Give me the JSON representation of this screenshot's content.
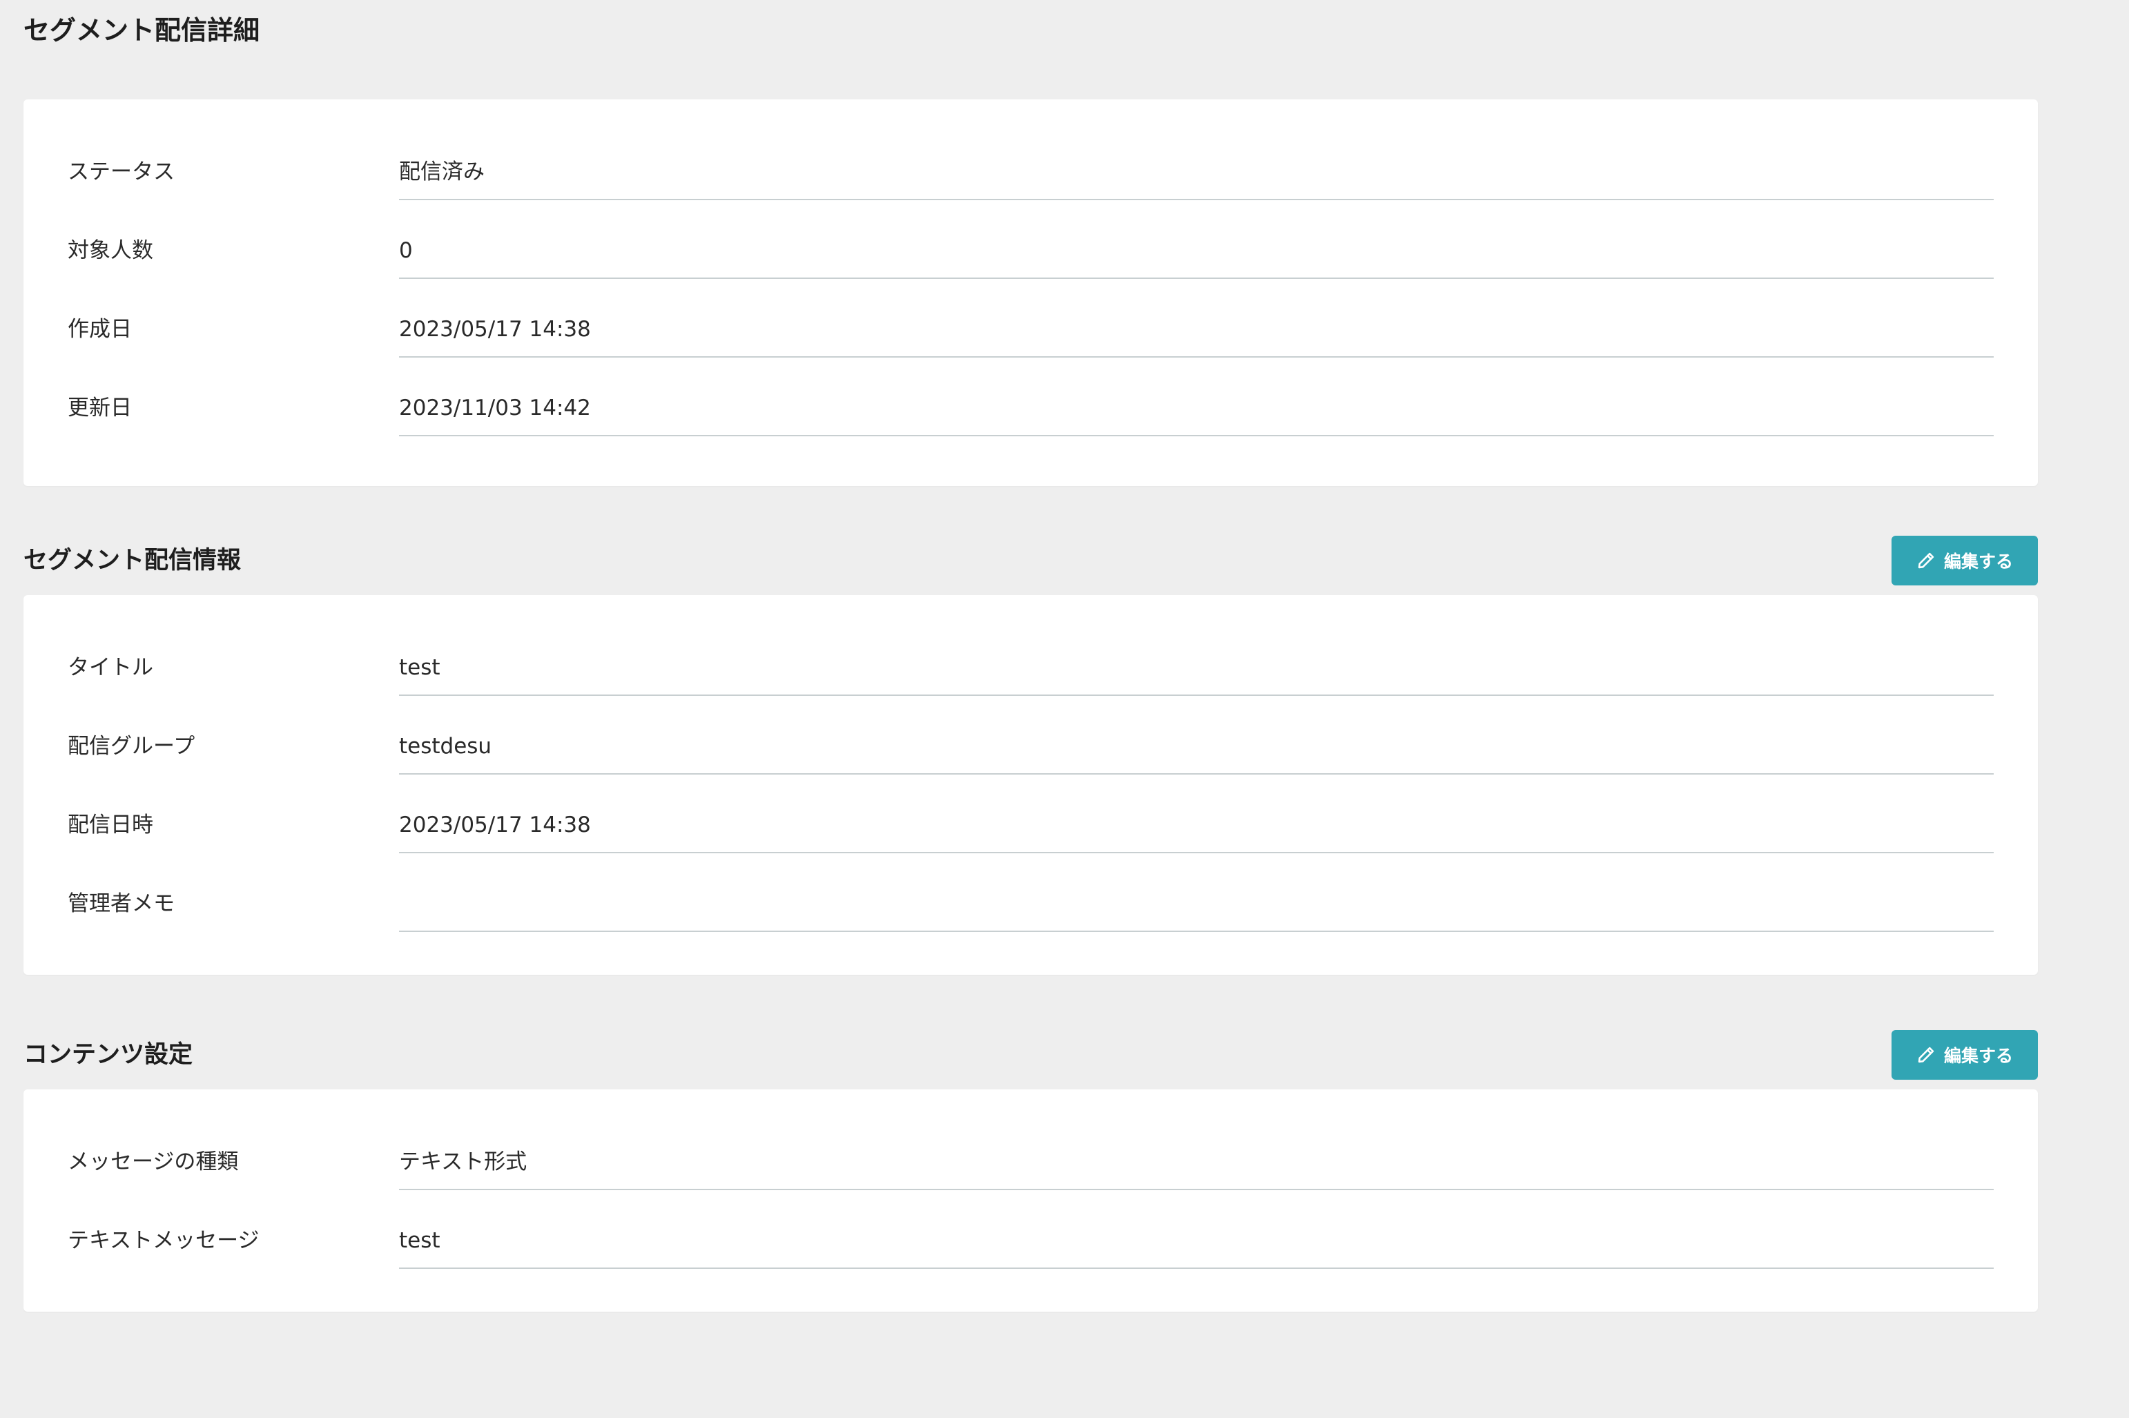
{
  "page": {
    "title": "セグメント配信詳細"
  },
  "summary": {
    "rows": [
      {
        "label": "ステータス",
        "value": "配信済み"
      },
      {
        "label": "対象人数",
        "value": "0"
      },
      {
        "label": "作成日",
        "value": "2023/05/17 14:38"
      },
      {
        "label": "更新日",
        "value": "2023/11/03 14:42"
      }
    ]
  },
  "delivery_info": {
    "title": "セグメント配信情報",
    "edit_label": "編集する",
    "rows": [
      {
        "label": "タイトル",
        "value": "test"
      },
      {
        "label": "配信グループ",
        "value": "testdesu"
      },
      {
        "label": "配信日時",
        "value": "2023/05/17 14:38"
      },
      {
        "label": "管理者メモ",
        "value": ""
      }
    ]
  },
  "content_settings": {
    "title": "コンテンツ設定",
    "edit_label": "編集する",
    "rows": [
      {
        "label": "メッセージの種類",
        "value": "テキスト形式"
      },
      {
        "label": "テキストメッセージ",
        "value": "test"
      }
    ]
  },
  "colors": {
    "background": "#eeeeee",
    "card": "#ffffff",
    "accent": "#31a5b4",
    "divider": "#c8cfd1"
  },
  "icons": {
    "edit": "pencil-icon"
  }
}
